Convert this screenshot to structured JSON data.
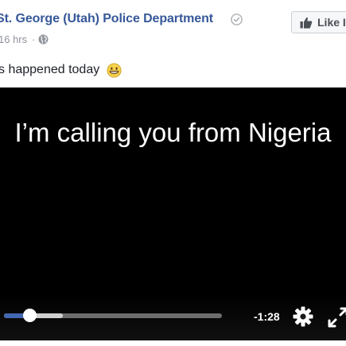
{
  "post": {
    "page_name": "St. George (Utah) Police Department",
    "timestamp": "16 hrs",
    "separator": "·",
    "text": "s happened today",
    "verified_icon": "verified-badge-icon",
    "audience_icon": "globe-icon",
    "emoji_icon": "grinning-face-icon"
  },
  "like_button": {
    "label": "Like I",
    "icon": "thumbs-up-icon"
  },
  "video": {
    "caption": "I’m calling you from Nigeria",
    "time_remaining": "-1:28",
    "played_fraction": 0.12,
    "buffered_fraction": 0.27,
    "settings_icon": "gear-icon",
    "fullscreen_icon": "fullscreen-icon"
  },
  "colors": {
    "page_name": "#365899",
    "meta": "#90949c",
    "progress_played": "#4267b2",
    "video_bg": "#000000"
  }
}
